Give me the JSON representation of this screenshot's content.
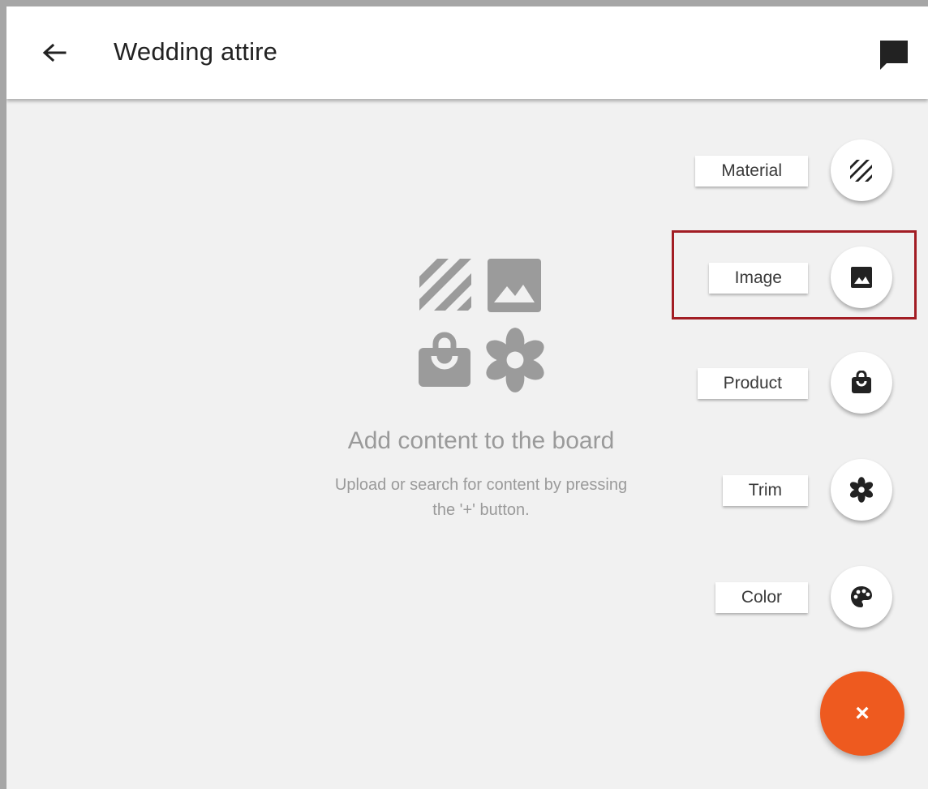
{
  "header": {
    "title": "Wedding attire",
    "back_icon": "arrow-left-icon",
    "comment_icon": "comment-icon"
  },
  "empty_state": {
    "heading": "Add content to the board",
    "subtext_line1": "Upload or search for content by pressing",
    "subtext_line2": "the '+' button."
  },
  "speed_dial": {
    "items": [
      {
        "label": "Material",
        "icon": "material-stripes-icon"
      },
      {
        "label": "Image",
        "icon": "image-icon"
      },
      {
        "label": "Product",
        "icon": "shopping-bag-icon"
      },
      {
        "label": "Trim",
        "icon": "flower-icon"
      },
      {
        "label": "Color",
        "icon": "palette-icon"
      }
    ],
    "close_label": "×",
    "highlighted_item": "Image"
  },
  "colors": {
    "accent": "#ee5a1f",
    "highlight": "#a21d24",
    "background": "#f1f1f1",
    "muted_text": "#9a9a9a"
  }
}
